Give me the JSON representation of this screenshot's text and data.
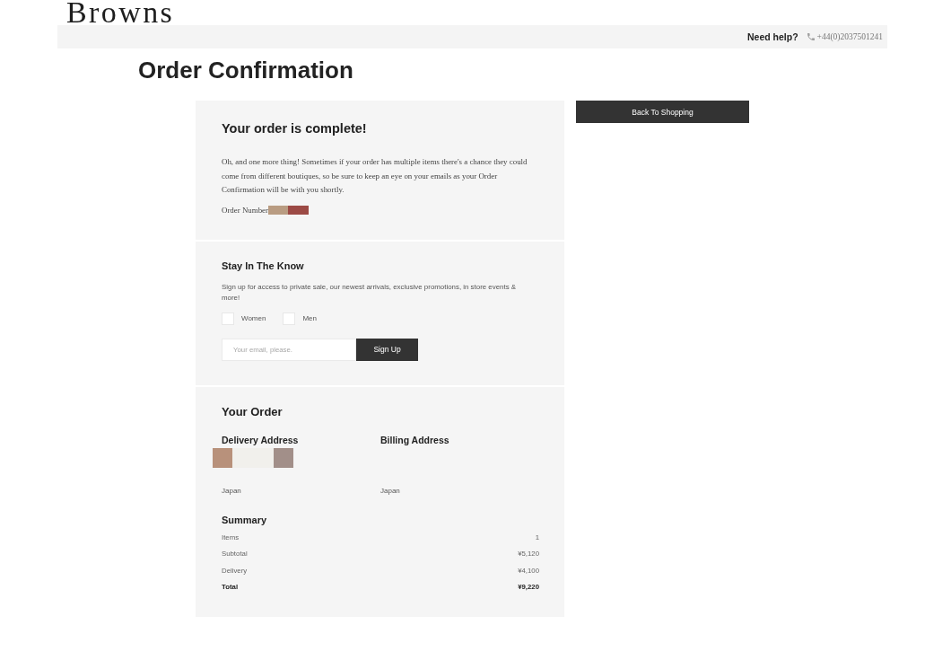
{
  "header": {
    "logo": "Browns",
    "help_label": "Need help?",
    "phone": "+44(0)2037501241"
  },
  "page_title": "Order Confirmation",
  "confirmation": {
    "title": "Your order is complete!",
    "message": "Oh, and one more thing! Sometimes if your order has multiple items there's a chance they could come from different boutiques, so be sure to keep an eye on your emails as your Order Confirmation will be with you shortly.",
    "order_number_label": "Order Number",
    "order_number_redacted": true
  },
  "newsletter": {
    "title": "Stay In The Know",
    "text": "Sign up for access to private sale, our newest arrivals, exclusive promotions, in store events & more!",
    "options": [
      {
        "label": "Women",
        "checked": false
      },
      {
        "label": "Men",
        "checked": false
      }
    ],
    "email": {
      "placeholder": "Your email, please."
    },
    "button": "Sign Up"
  },
  "order": {
    "title": "Your Order",
    "addresses": [
      {
        "heading": "Delivery Address",
        "redacted": true,
        "country": "Japan"
      },
      {
        "heading": "Billing Address",
        "redacted": false,
        "country": "Japan"
      }
    ],
    "summary": {
      "title": "Summary",
      "rows": [
        {
          "kind": "line",
          "label": "Items",
          "value": "1"
        },
        {
          "kind": "line",
          "label": "Subtotal",
          "value": "¥5,120"
        },
        {
          "kind": "line",
          "label": "Delivery",
          "value": "¥4,100"
        },
        {
          "kind": "total",
          "label": "Total",
          "value": "¥9,220"
        }
      ]
    }
  },
  "back_button": "Back To Shopping"
}
